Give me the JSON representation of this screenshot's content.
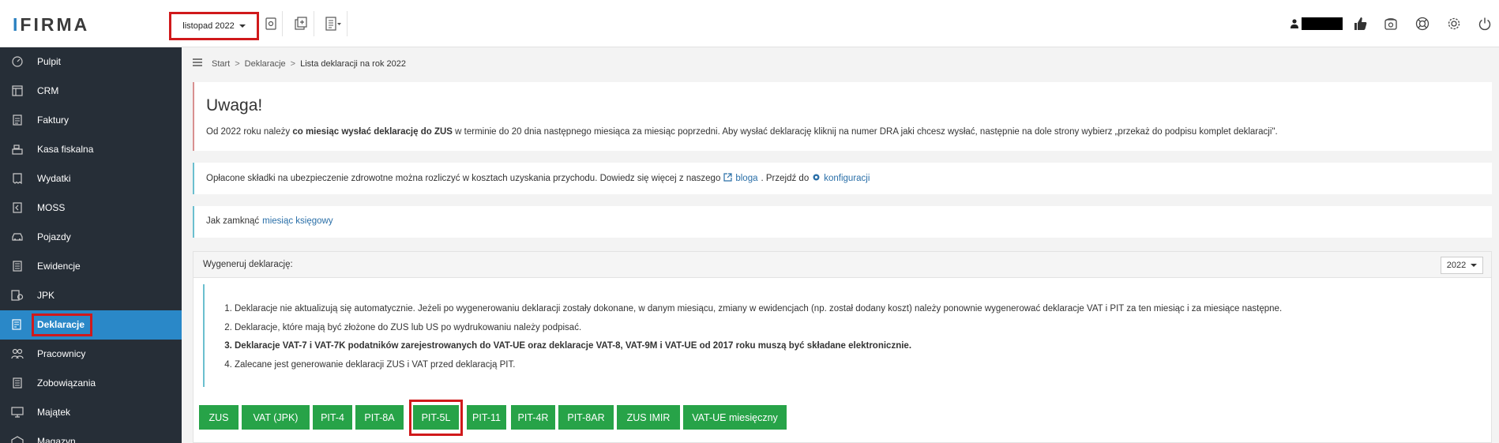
{
  "brand": {
    "logo_text": "IFIRMA",
    "logo_first": "I"
  },
  "topbar": {
    "month": "listopad 2022"
  },
  "sidebar": {
    "items": [
      {
        "label": "Pulpit",
        "icon": "gauge-icon"
      },
      {
        "label": "CRM",
        "icon": "table-icon"
      },
      {
        "label": "Faktury",
        "icon": "document-icon"
      },
      {
        "label": "Kasa fiskalna",
        "icon": "cash-register-icon"
      },
      {
        "label": "Wydatki",
        "icon": "receipt-icon"
      },
      {
        "label": "MOSS",
        "icon": "moss-icon"
      },
      {
        "label": "Pojazdy",
        "icon": "car-icon"
      },
      {
        "label": "Ewidencje",
        "icon": "records-icon"
      },
      {
        "label": "JPK",
        "icon": "jpk-icon"
      },
      {
        "label": "Deklaracje",
        "icon": "declaration-icon",
        "active": true
      },
      {
        "label": "Pracownicy",
        "icon": "employees-icon"
      },
      {
        "label": "Zobowiązania",
        "icon": "liabilities-icon"
      },
      {
        "label": "Majątek",
        "icon": "monitor-icon"
      },
      {
        "label": "Magazyn",
        "icon": "warehouse-icon"
      }
    ]
  },
  "breadcrumb": {
    "items": [
      "Start",
      "Deklaracje",
      "Lista deklaracji na rok 2022"
    ]
  },
  "warning": {
    "title": "Uwaga!",
    "text_before": "Od 2022 roku należy ",
    "text_bold": "co miesiąc wysłać deklarację do ZUS",
    "text_after": " w terminie do 20 dnia następnego miesiąca za miesiąc poprzedni. Aby wysłać deklarację kliknij na numer DRA jaki chcesz wysłać, następnie na dole strony wybierz „przekaż do podpisu komplet deklaracji\"."
  },
  "info_health": {
    "text": "Opłacone składki na ubezpieczenie zdrowotne można rozliczyć w kosztach uzyskania przychodu. Dowiedz się więcej z naszego",
    "blog_link": "bloga",
    "middle": ". Przejdź do",
    "config_link": "konfiguracji"
  },
  "info_close": {
    "text": "Jak zamknąć",
    "link": "miesiąc księgowy"
  },
  "panel": {
    "title": "Wygeneruj deklarację:",
    "year": "2022",
    "notes": [
      "Deklaracje nie aktualizują się automatycznie. Jeżeli po wygenerowaniu deklaracji zostały dokonane, w danym miesiącu, zmiany w ewidencjach (np. został dodany koszt) należy ponownie wygenerować deklaracje VAT i PIT za ten miesiąc i za miesiące następne.",
      "Deklaracje, które mają być złożone do ZUS lub US po wydrukowaniu należy podpisać.",
      "Deklaracje VAT-7 i VAT-7K podatników zarejestrowanych do VAT-UE oraz deklaracje VAT-8, VAT-9M i VAT-UE od 2017 roku muszą być składane elektronicznie.",
      "Zalecane jest generowanie deklaracji ZUS i VAT przed deklaracją PIT."
    ],
    "buttons": [
      "ZUS",
      "VAT (JPK)",
      "PIT-4",
      "PIT-8A",
      "PIT-5L",
      "PIT-11",
      "PIT-4R",
      "PIT-8AR",
      "ZUS IMIR",
      "VAT-UE miesięczny"
    ]
  },
  "colors": {
    "sidebar_bg": "#262e37",
    "active_bg": "#2a88c8",
    "button_green": "#27a348",
    "highlight_red": "#d0191b",
    "link_blue": "#2a6fa8"
  }
}
